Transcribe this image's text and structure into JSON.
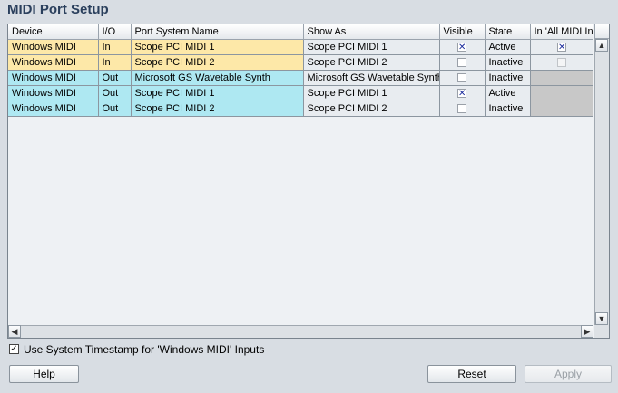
{
  "title": "MIDI Port Setup",
  "columns": [
    "Device",
    "I/O",
    "Port System Name",
    "Show As",
    "Visible",
    "State",
    "In 'All MIDI Inputs'"
  ],
  "rows": [
    {
      "device": "Windows MIDI",
      "io": "In",
      "name": "Scope PCI MIDI 1",
      "show": "Scope PCI MIDI 1",
      "visible": true,
      "state": "Active",
      "all_inputs": true,
      "kind": "in"
    },
    {
      "device": "Windows MIDI",
      "io": "In",
      "name": "Scope PCI MIDI 2",
      "show": "Scope PCI MIDI 2",
      "visible": false,
      "state": "Inactive",
      "all_inputs": false,
      "kind": "in"
    },
    {
      "device": "Windows MIDI",
      "io": "Out",
      "name": "Microsoft GS Wavetable Synth",
      "show": "Microsoft GS Wavetable Synth",
      "visible": false,
      "state": "Inactive",
      "all_inputs": null,
      "kind": "out"
    },
    {
      "device": "Windows MIDI",
      "io": "Out",
      "name": "Scope PCI MIDI 1",
      "show": "Scope PCI MIDI 1",
      "visible": true,
      "state": "Active",
      "all_inputs": null,
      "kind": "out"
    },
    {
      "device": "Windows MIDI",
      "io": "Out",
      "name": "Scope PCI MIDI 2",
      "show": "Scope PCI MIDI 2",
      "visible": false,
      "state": "Inactive",
      "all_inputs": null,
      "kind": "out"
    }
  ],
  "timestamp_option": {
    "label": "Use System Timestamp for 'Windows MIDI' Inputs",
    "checked": true
  },
  "buttons": {
    "help": "Help",
    "reset": "Reset",
    "apply": "Apply"
  },
  "checkmark": "✕",
  "scroll_glyphs": {
    "up": "▲",
    "down": "▼",
    "left": "◀",
    "right": "▶"
  }
}
